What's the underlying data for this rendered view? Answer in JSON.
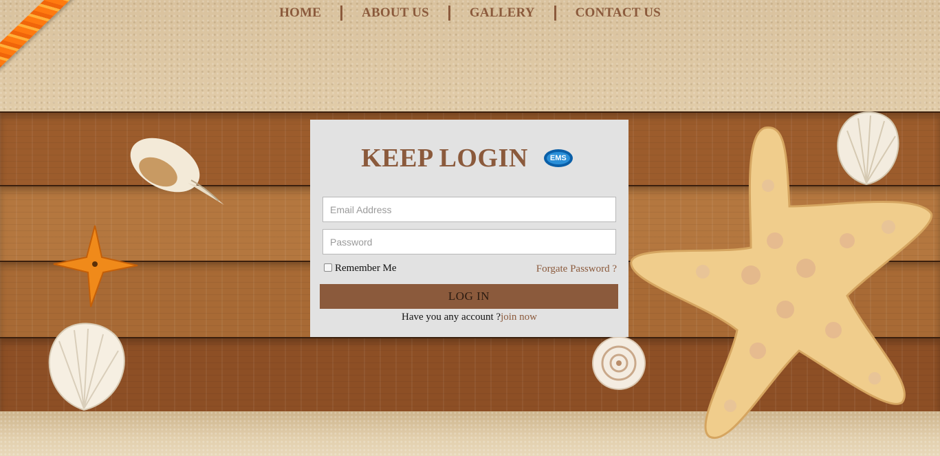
{
  "nav": {
    "items": [
      {
        "label": "HOME"
      },
      {
        "label": "ABOUT US"
      },
      {
        "label": "GALLERY"
      },
      {
        "label": "CONTACT US"
      }
    ]
  },
  "login": {
    "title": "KEEP LOGIN",
    "logo_text": "EMS",
    "email_placeholder": "Email Address",
    "password_placeholder": "Password",
    "remember_label": "Remember Me",
    "forgot_label": "Forgate Password ?",
    "button_label": "LOG IN",
    "signup_prompt": "Have you any account ?",
    "join_label": "join now"
  },
  "colors": {
    "accent_brown": "#8b5a3c",
    "card_background": "#e2e2e2",
    "logo_blue": "#0a5fa8"
  },
  "icons": [
    "ems-logo-icon",
    "starfish-icon",
    "seashell-icon",
    "rope-decoration"
  ]
}
